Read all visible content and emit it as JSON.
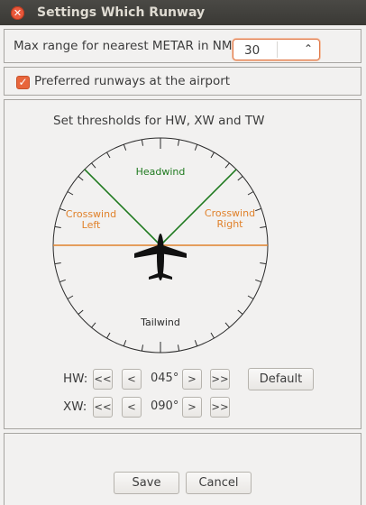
{
  "window": {
    "title": "Settings Which Runway"
  },
  "range": {
    "label": "Max range for nearest METAR in NM:",
    "value": "30"
  },
  "preferred": {
    "label": "Preferred runways at the airport",
    "checked": true
  },
  "thresholds": {
    "heading": "Set thresholds for HW, XW and TW",
    "dial": {
      "headwind": "Headwind",
      "crosswind_left": [
        "Crosswind",
        "Left"
      ],
      "crosswind_right": [
        "Crosswind",
        "Right"
      ],
      "tailwind": "Tailwind",
      "headwind_color": "#1f7a1f",
      "crosswind_color": "#e0812a"
    },
    "hw": {
      "label": "HW:",
      "value": "045°"
    },
    "xw": {
      "label": "XW:",
      "value": "090°"
    },
    "buttons": {
      "fast_back": "<<",
      "back": "<",
      "forward": ">",
      "fast_forward": ">>",
      "default": "Default"
    }
  },
  "footer": {
    "save": "Save",
    "cancel": "Cancel"
  }
}
